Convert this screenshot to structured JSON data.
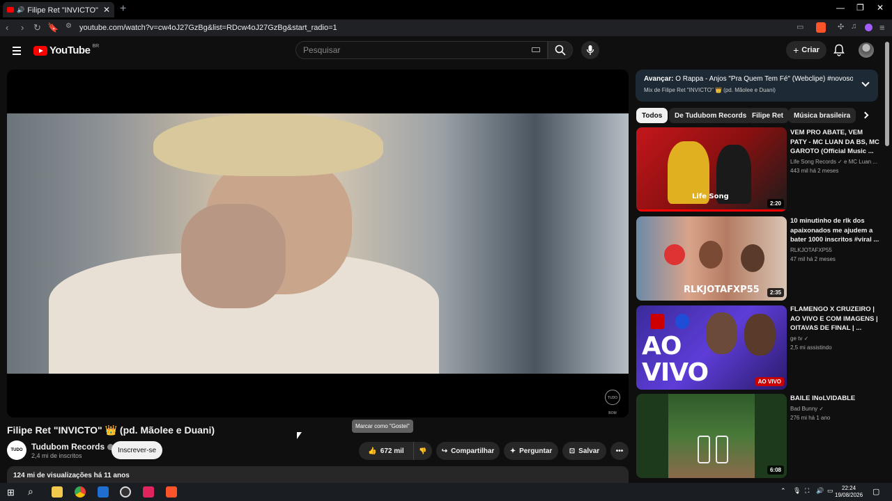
{
  "browser": {
    "tab_title": "Filipe Ret \"INVICTO\" 👑 (pd.",
    "url": "youtube.com/watch?v=cw4oJ27GzBg&list=RDcw4oJ27GzBg&start_radio=1"
  },
  "header": {
    "logo_text": "YouTube",
    "country": "BR",
    "search_placeholder": "Pesquisar",
    "create_label": "Criar"
  },
  "video": {
    "title": "Filipe Ret \"INVICTO\" 👑 (pd. Mãolee e Duani)",
    "channel": "Tudubom Records",
    "channel_avatar_text": "TUDO BOM",
    "subscribers": "2,4 mi de inscritos",
    "subscribe_label": "Inscrever-se",
    "likes": "672 mil",
    "share_label": "Compartilhar",
    "ask_label": "Perguntar",
    "save_label": "Salvar",
    "tooltip": "Marcar como \"Gostei\"",
    "stats": "124 mi de visualizações  há 11 anos",
    "watermark": "TUDO BOM"
  },
  "up_next": {
    "prefix": "Avançar:",
    "title": "O Rappa - Anjos \"Pra Quem Tem Fé\" (Webclipe) #novosomdo...",
    "mix": "Mix de Filipe Ret \"INVICTO\" 👑 (pd. Mãolee e Duani)"
  },
  "chips": [
    "Todos",
    "De Tudubom Records",
    "Filipe Ret",
    "Música brasileira"
  ],
  "recommendations": [
    {
      "title": "VEM PRO ABATE, VEM PATY - MC LUAN DA BS, MC GAROTO (Official Music ...",
      "channel": "Life Song Records ✓ e MC Luan ...",
      "meta": "443 mil   há 2 meses",
      "duration": "2:20",
      "thumb_text": "Life Song",
      "progress": 1.0
    },
    {
      "title": "10 minutinho de rlk dos apaixonados me ajudem a bater 1000 inscritos #viral ...",
      "channel": "RLKJOTAFXP55",
      "meta": "47 mil   há 2 meses",
      "duration": "2:35",
      "thumb_text": "RLKJOTAFXP55"
    },
    {
      "title": "FLAMENGO X CRUZEIRO | AO VIVO E COM IMAGENS | OITAVAS DE FINAL | ...",
      "channel": "ge tv ✓",
      "meta": "2,5 mi assistindo",
      "duration": "AO VIVO",
      "thumb_text": "AO VIVO"
    },
    {
      "title": "BAILE INoLVIDABLE",
      "channel": "Bad Bunny ✓",
      "meta": "276 mi   há 1 ano",
      "duration": "6:08",
      "thumb_text": ""
    }
  ],
  "taskbar": {
    "time": "22:24",
    "date": "19/08/2026"
  }
}
